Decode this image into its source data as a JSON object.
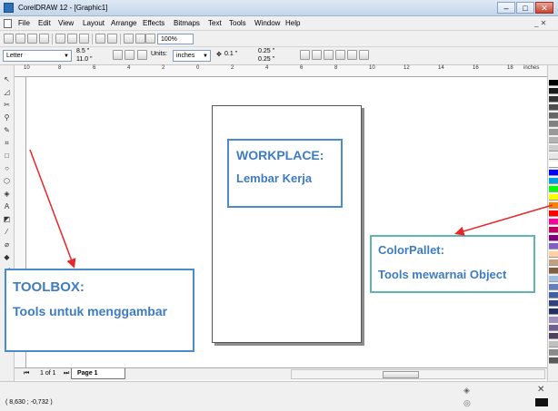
{
  "window": {
    "title": "CorelDRAW 12 - [Graphic1]",
    "controls": {
      "minimize": "–",
      "maximize": "□",
      "close": "✕"
    },
    "mdi_controls": "_ ✕"
  },
  "menu": {
    "items": [
      "File",
      "Edit",
      "View",
      "Layout",
      "Arrange",
      "Effects",
      "Bitmaps",
      "Text",
      "Tools",
      "Window",
      "Help"
    ]
  },
  "toolbar": {
    "zoom_value": "100%"
  },
  "property_bar": {
    "paper_preset": "Letter",
    "width_value": "8.5 \"",
    "height_value": "11.0 \"",
    "units_label": "Units:",
    "units_value": "inches",
    "nudge_value": "0.1 \"",
    "dup_x": "0.25 \"",
    "dup_y": "0.25 \""
  },
  "ruler": {
    "top_ticks": [
      "10",
      "8",
      "6",
      "4",
      "2",
      "0",
      "2",
      "4",
      "6",
      "8",
      "10",
      "12",
      "14",
      "16",
      "18"
    ],
    "units_label": "inches"
  },
  "pages": {
    "counter": "1 of 1",
    "tab_label": "Page 1"
  },
  "status": {
    "coordinates": "( 8,630 ; -0,732 )"
  },
  "annotations": {
    "workplace_title": "WORKPLACE:",
    "workplace_desc": "Lembar Kerja",
    "toolbox_title": "TOOLBOX:",
    "toolbox_desc": "Tools untuk menggambar",
    "colorpallet_title": "ColorPallet:",
    "colorpallet_desc": "Tools mewarnai Object"
  },
  "colors": {
    "callout_text": "#3e7cc2",
    "callout_border": "#4a8cc8",
    "arrow": "#e8262a"
  },
  "palette_swatches": [
    "#000000",
    "#1a1a1a",
    "#333333",
    "#4d4d4d",
    "#666666",
    "#808080",
    "#999999",
    "#b3b3b3",
    "#cccccc",
    "#e6e6e6",
    "#ffffff",
    "#0000ff",
    "#00a0e0",
    "#00ff00",
    "#ffff00",
    "#ff8000",
    "#ff0000",
    "#ff00a0",
    "#c00060",
    "#800080",
    "#8060c0",
    "#ffd0a0",
    "#c0a080",
    "#806040",
    "#a0c0e0",
    "#6080c0",
    "#4060a0",
    "#304080",
    "#203060",
    "#a090c0",
    "#706090",
    "#504060",
    "#c0c0c0",
    "#8a8a8a",
    "#5a5a5a"
  ]
}
